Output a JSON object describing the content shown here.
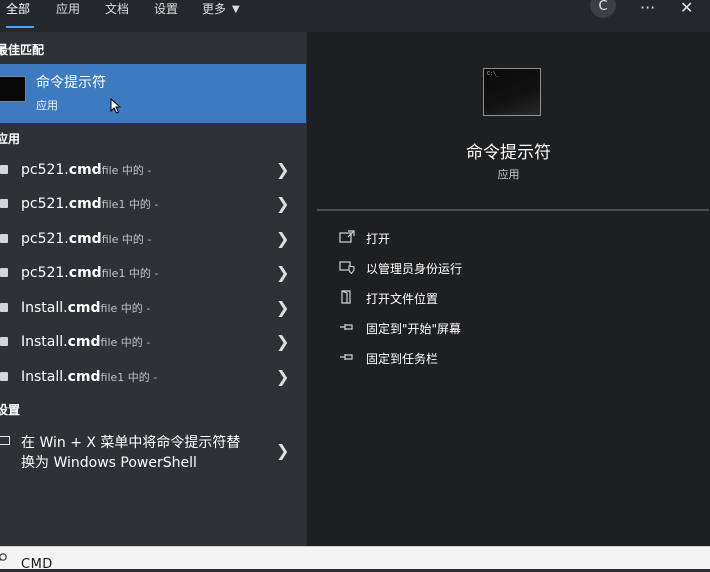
{
  "tabs": [
    {
      "label": "全部",
      "active": true
    },
    {
      "label": "应用"
    },
    {
      "label": "文档"
    },
    {
      "label": "设置"
    },
    {
      "label": "更多"
    }
  ],
  "header": {
    "avatar_letter": "C",
    "more_glyph": "···",
    "close_glyph": "✕"
  },
  "left": {
    "best_match_header": "最佳匹配",
    "best_match": {
      "name": "命令提示符",
      "type": "应用"
    },
    "apps_header": "应用",
    "results": [
      {
        "name_prefix": "pc521.",
        "name_bold": "cmd",
        "context": "file 中的 -"
      },
      {
        "name_prefix": "pc521.",
        "name_bold": "cmd",
        "context": "file1 中的 -"
      },
      {
        "name_prefix": "pc521.",
        "name_bold": "cmd",
        "context": "file 中的 -"
      },
      {
        "name_prefix": "pc521.",
        "name_bold": "cmd",
        "context": "file1 中的 -"
      },
      {
        "name_prefix": "Install.",
        "name_bold": "cmd",
        "context": "file 中的 -"
      },
      {
        "name_prefix": "Install.",
        "name_bold": "cmd",
        "context": "file 中的 -"
      },
      {
        "name_prefix": "Install.",
        "name_bold": "cmd",
        "context": "file1 中的 -"
      }
    ],
    "settings_header": "设置",
    "setting": {
      "line1": "在 Win + X 菜单中将命令提示符替",
      "line2": "换为 Windows PowerShell"
    }
  },
  "detail": {
    "title": "命令提示符",
    "type": "应用",
    "actions": [
      {
        "label": "打开",
        "icon": "open-icon"
      },
      {
        "label": "以管理员身份运行",
        "icon": "shield-icon"
      },
      {
        "label": "打开文件位置",
        "icon": "folder-icon"
      },
      {
        "label": "固定到\"开始\"屏幕",
        "icon": "pin-icon"
      },
      {
        "label": "固定到任务栏",
        "icon": "pin-icon"
      }
    ]
  },
  "search": {
    "query": "CMD"
  },
  "colors": {
    "accent": "#4fa3f7",
    "selected": "#3e7ac0",
    "panel_left": "#2e3135",
    "panel_right": "#1e1f21"
  }
}
